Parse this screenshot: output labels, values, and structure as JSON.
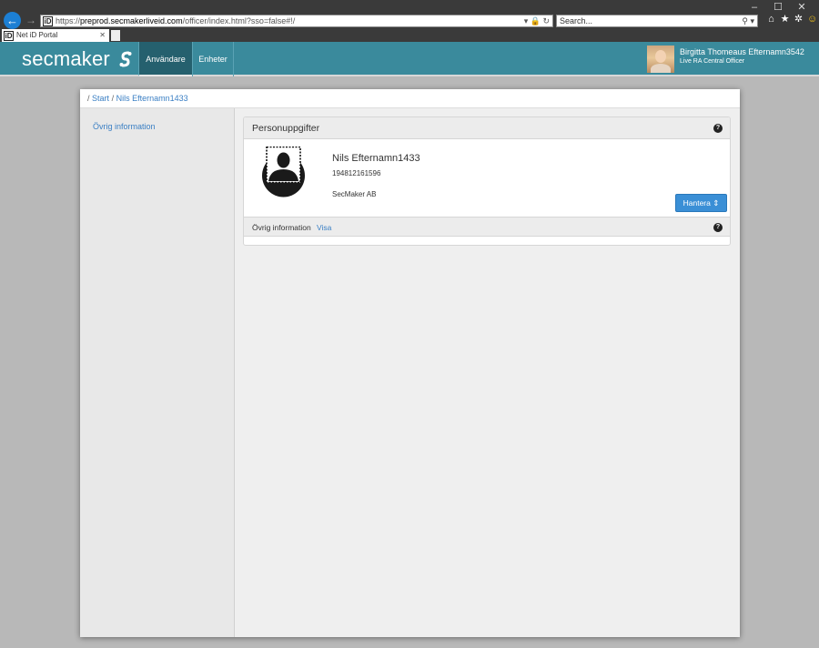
{
  "browser": {
    "url_scheme": "https://",
    "url_host": "preprod.secmakerliveid.com",
    "url_path": "/officer/index.html?sso=false#!/",
    "search_placeholder": "Search...",
    "tab_title": "Net iD Portal",
    "site_icon_label": "iD",
    "window_controls": [
      "–",
      "☐",
      "✕"
    ]
  },
  "header": {
    "logo_text": "secmaker",
    "nav": [
      {
        "label": "Användare",
        "active": true
      },
      {
        "label": "Enheter",
        "active": false
      }
    ],
    "user": {
      "name": "Birgitta Thomeaus Efternamn3542",
      "role": "Live RA Central Officer"
    }
  },
  "breadcrumb": {
    "separator": "/",
    "items": [
      "Start",
      "Nils Efternamn1433"
    ]
  },
  "sidebar": {
    "items": [
      "Övrig information"
    ]
  },
  "personal_panel": {
    "title": "Personuppgifter",
    "name": "Nils Efternamn1433",
    "id_number": "194812161596",
    "organization": "SecMaker AB",
    "manage_button": "Hantera",
    "other_info_label": "Övrig information",
    "other_info_link": "Visa"
  },
  "colors": {
    "header_teal": "#3a8a9c",
    "active_tab": "#25606e",
    "link_blue": "#3a7fc4",
    "button_blue": "#3a8fd6"
  }
}
